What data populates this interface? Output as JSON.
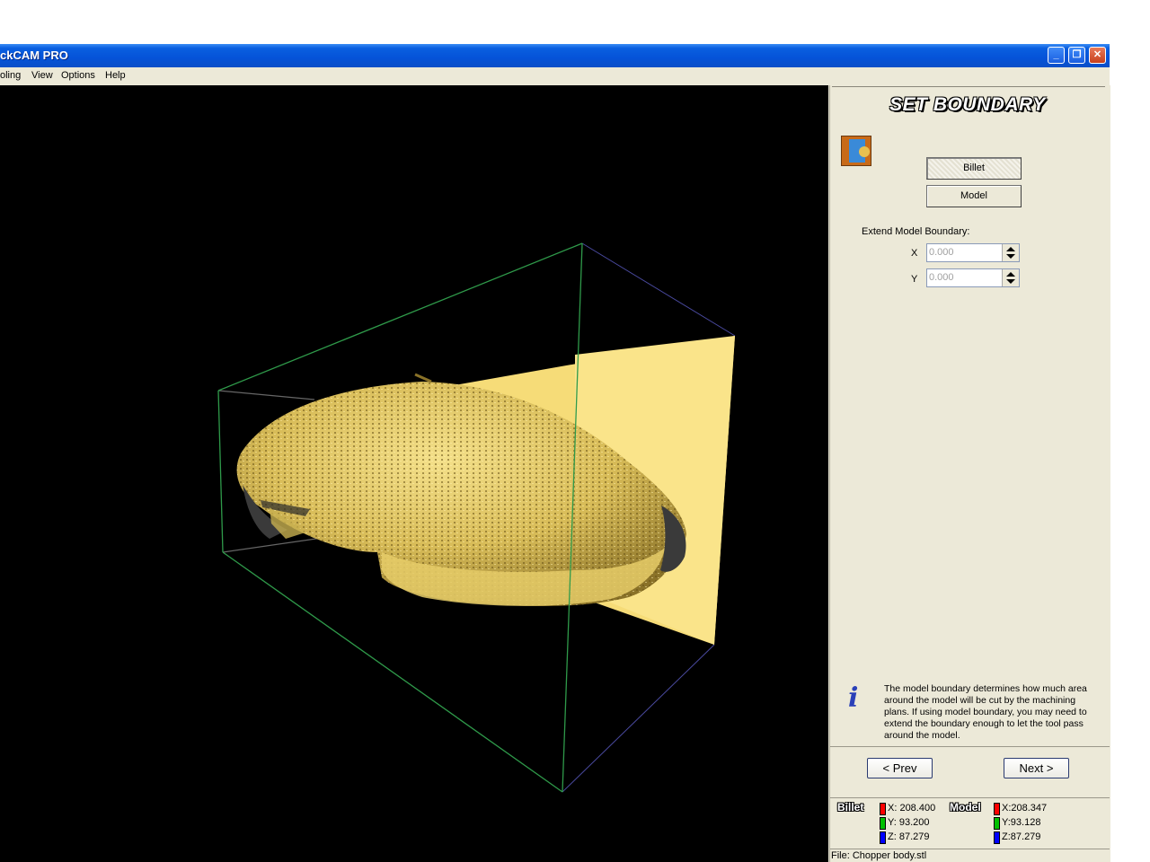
{
  "window": {
    "title": "ckCAM PRO",
    "controls": {
      "minimize": "_",
      "maximize": "❐",
      "close": "✕"
    }
  },
  "menu": [
    "oling",
    "View",
    "Options",
    "Help"
  ],
  "panel": {
    "heading": "SET BOUNDARY",
    "billet_button": "Billet",
    "model_button": "Model",
    "selected": "Billet",
    "extend_label": "Extend Model Boundary:",
    "x_label": "X",
    "x_value": "0.000",
    "y_label": "Y",
    "y_value": "0.000",
    "info_glyph": "i",
    "info_text": "The model boundary determines how much area around the model will be cut by the machining plans. If using model boundary, you may need to extend the boundary enough to let the tool pass around the model.",
    "prev_button": "< Prev",
    "next_button": "Next >"
  },
  "stats": {
    "billet": {
      "title": "Billet",
      "x": "X: 208.400",
      "y": "Y: 93.200",
      "z": "Z: 87.279"
    },
    "model": {
      "title": "Model",
      "x": "X:208.347",
      "y": "Y:93.128",
      "z": "Z:87.279"
    }
  },
  "status": {
    "file": "File: Chopper body.stl"
  },
  "colors": {
    "axis_x": "#ff0000",
    "axis_y": "#00c000",
    "axis_z": "#0000ff",
    "model": "#e8d070",
    "box_edge": "#2f9a4a"
  }
}
